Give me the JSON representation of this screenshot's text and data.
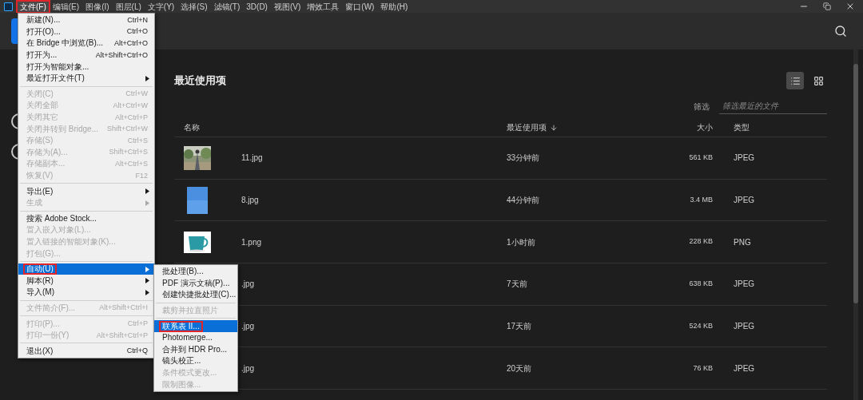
{
  "menubar": {
    "items": [
      {
        "label": "文件(F)",
        "selected": true,
        "outlined": true
      },
      {
        "label": "编辑(E)",
        "selected": false,
        "outlined": false
      },
      {
        "label": "图像(I)",
        "selected": false,
        "outlined": false
      },
      {
        "label": "图层(L)",
        "selected": false,
        "outlined": false
      },
      {
        "label": "文字(Y)",
        "selected": false,
        "outlined": false
      },
      {
        "label": "选择(S)",
        "selected": false,
        "outlined": false
      },
      {
        "label": "滤镜(T)",
        "selected": false,
        "outlined": false
      },
      {
        "label": "3D(D)",
        "selected": false,
        "outlined": false
      },
      {
        "label": "视图(V)",
        "selected": false,
        "outlined": false
      },
      {
        "label": "增效工具",
        "selected": false,
        "outlined": false
      },
      {
        "label": "窗口(W)",
        "selected": false,
        "outlined": false
      },
      {
        "label": "帮助(H)",
        "selected": false,
        "outlined": false
      }
    ]
  },
  "file_menu": [
    {
      "kind": "item",
      "label": "新建(N)...",
      "shortcut": "Ctrl+N",
      "disabled": false,
      "submenu": false,
      "selected": false,
      "outlined": false
    },
    {
      "kind": "item",
      "label": "打开(O)...",
      "shortcut": "Ctrl+O",
      "disabled": false,
      "submenu": false,
      "selected": false,
      "outlined": false
    },
    {
      "kind": "item",
      "label": "在 Bridge 中浏览(B)...",
      "shortcut": "Alt+Ctrl+O",
      "disabled": false,
      "submenu": false,
      "selected": false,
      "outlined": false
    },
    {
      "kind": "item",
      "label": "打开为...",
      "shortcut": "Alt+Shift+Ctrl+O",
      "disabled": false,
      "submenu": false,
      "selected": false,
      "outlined": false
    },
    {
      "kind": "item",
      "label": "打开为智能对象...",
      "disabled": false,
      "submenu": false,
      "selected": false,
      "outlined": false
    },
    {
      "kind": "item",
      "label": "最近打开文件(T)",
      "disabled": false,
      "submenu": true,
      "selected": false,
      "outlined": false
    },
    {
      "kind": "separator"
    },
    {
      "kind": "item",
      "label": "关闭(C)",
      "shortcut": "Ctrl+W",
      "disabled": true,
      "submenu": false,
      "selected": false,
      "outlined": false
    },
    {
      "kind": "item",
      "label": "关闭全部",
      "shortcut": "Alt+Ctrl+W",
      "disabled": true,
      "submenu": false,
      "selected": false,
      "outlined": false
    },
    {
      "kind": "item",
      "label": "关闭其它",
      "shortcut": "Alt+Ctrl+P",
      "disabled": true,
      "submenu": false,
      "selected": false,
      "outlined": false
    },
    {
      "kind": "item",
      "label": "关闭并转到 Bridge...",
      "shortcut": "Shift+Ctrl+W",
      "disabled": true,
      "submenu": false,
      "selected": false,
      "outlined": false
    },
    {
      "kind": "item",
      "label": "存储(S)",
      "shortcut": "Ctrl+S",
      "disabled": true,
      "submenu": false,
      "selected": false,
      "outlined": false
    },
    {
      "kind": "item",
      "label": "存储为(A)...",
      "shortcut": "Shift+Ctrl+S",
      "disabled": true,
      "submenu": false,
      "selected": false,
      "outlined": false
    },
    {
      "kind": "item",
      "label": "存储副本...",
      "shortcut": "Alt+Ctrl+S",
      "disabled": true,
      "submenu": false,
      "selected": false,
      "outlined": false
    },
    {
      "kind": "item",
      "label": "恢复(V)",
      "shortcut": "F12",
      "disabled": true,
      "submenu": false,
      "selected": false,
      "outlined": false
    },
    {
      "kind": "separator"
    },
    {
      "kind": "item",
      "label": "导出(E)",
      "disabled": false,
      "submenu": true,
      "selected": false,
      "outlined": false
    },
    {
      "kind": "item",
      "label": "生成",
      "disabled": true,
      "submenu": true,
      "selected": false,
      "outlined": false
    },
    {
      "kind": "separator"
    },
    {
      "kind": "item",
      "label": "搜索 Adobe Stock...",
      "disabled": false,
      "submenu": false,
      "selected": false,
      "outlined": false
    },
    {
      "kind": "item",
      "label": "置入嵌入对象(L)...",
      "disabled": true,
      "submenu": false,
      "selected": false,
      "outlined": false
    },
    {
      "kind": "item",
      "label": "置入链接的智能对象(K)...",
      "disabled": true,
      "submenu": false,
      "selected": false,
      "outlined": false
    },
    {
      "kind": "item",
      "label": "打包(G)...",
      "disabled": true,
      "submenu": false,
      "selected": false,
      "outlined": false
    },
    {
      "kind": "separator"
    },
    {
      "kind": "item",
      "label": "自动(U)",
      "disabled": false,
      "submenu": true,
      "selected": true,
      "outlined": true
    },
    {
      "kind": "item",
      "label": "脚本(R)",
      "disabled": false,
      "submenu": true,
      "selected": false,
      "outlined": false
    },
    {
      "kind": "item",
      "label": "导入(M)",
      "disabled": false,
      "submenu": true,
      "selected": false,
      "outlined": false
    },
    {
      "kind": "separator"
    },
    {
      "kind": "item",
      "label": "文件简介(F)...",
      "shortcut": "Alt+Shift+Ctrl+I",
      "disabled": true,
      "submenu": false,
      "selected": false,
      "outlined": false
    },
    {
      "kind": "separator"
    },
    {
      "kind": "item",
      "label": "打印(P)...",
      "shortcut": "Ctrl+P",
      "disabled": true,
      "submenu": false,
      "selected": false,
      "outlined": false
    },
    {
      "kind": "item",
      "label": "打印一份(Y)",
      "shortcut": "Alt+Shift+Ctrl+P",
      "disabled": true,
      "submenu": false,
      "selected": false,
      "outlined": false
    },
    {
      "kind": "separator"
    },
    {
      "kind": "item",
      "label": "退出(X)",
      "shortcut": "Ctrl+Q",
      "disabled": false,
      "submenu": false,
      "selected": false,
      "outlined": false
    }
  ],
  "automate_submenu": [
    {
      "kind": "item",
      "label": "批处理(B)...",
      "disabled": false,
      "selected": false,
      "outlined": false
    },
    {
      "kind": "item",
      "label": "PDF 演示文稿(P)...",
      "disabled": false,
      "selected": false,
      "outlined": false
    },
    {
      "kind": "item",
      "label": "创建快捷批处理(C)...",
      "disabled": false,
      "selected": false,
      "outlined": false
    },
    {
      "kind": "separator"
    },
    {
      "kind": "item",
      "label": "裁剪并拉直照片",
      "disabled": true,
      "selected": false,
      "outlined": false
    },
    {
      "kind": "separator"
    },
    {
      "kind": "item",
      "label": "联系表 II...",
      "disabled": false,
      "selected": true,
      "outlined": true
    },
    {
      "kind": "item",
      "label": "Photomerge...",
      "disabled": false,
      "selected": false,
      "outlined": false
    },
    {
      "kind": "item",
      "label": "合并到 HDR Pro...",
      "disabled": false,
      "selected": false,
      "outlined": false
    },
    {
      "kind": "item",
      "label": "镜头校正...",
      "disabled": false,
      "selected": false,
      "outlined": false
    },
    {
      "kind": "item",
      "label": "条件模式更改...",
      "disabled": true,
      "selected": false,
      "outlined": false
    },
    {
      "kind": "item",
      "label": "限制图像...",
      "disabled": true,
      "selected": false,
      "outlined": false
    }
  ],
  "recent": {
    "title": "最近使用项",
    "views": [
      {
        "kind": "list",
        "selected": true
      },
      {
        "kind": "grid",
        "selected": false
      }
    ],
    "filter": {
      "label": "筛选",
      "placeholder": "筛选最近的文件"
    },
    "columns": [
      {
        "label": "名称"
      },
      {
        "label": "最近使用项",
        "sort_descending": true
      },
      {
        "label": "大小"
      },
      {
        "label": "类型"
      }
    ],
    "rows": [
      {
        "thumbnail": true,
        "name": "11.jpg",
        "recent": "33分钟前",
        "size": "561 KB",
        "type": "JPEG"
      },
      {
        "thumbnail": true,
        "name": "8.jpg",
        "recent": "44分钟前",
        "size": "3.4 MB",
        "type": "JPEG"
      },
      {
        "thumbnail": true,
        "name": "1.png",
        "recent": "1小时前",
        "size": "228 KB",
        "type": "PNG"
      },
      {
        "name": ".jpg",
        "recent": "7天前",
        "size": "638 KB",
        "type": "JPEG"
      },
      {
        "name": ".jpg",
        "recent": "17天前",
        "size": "524 KB",
        "type": "JPEG"
      },
      {
        "name": ".jpg",
        "recent": "20天前",
        "size": "76 KB",
        "type": "JPEG"
      }
    ]
  }
}
